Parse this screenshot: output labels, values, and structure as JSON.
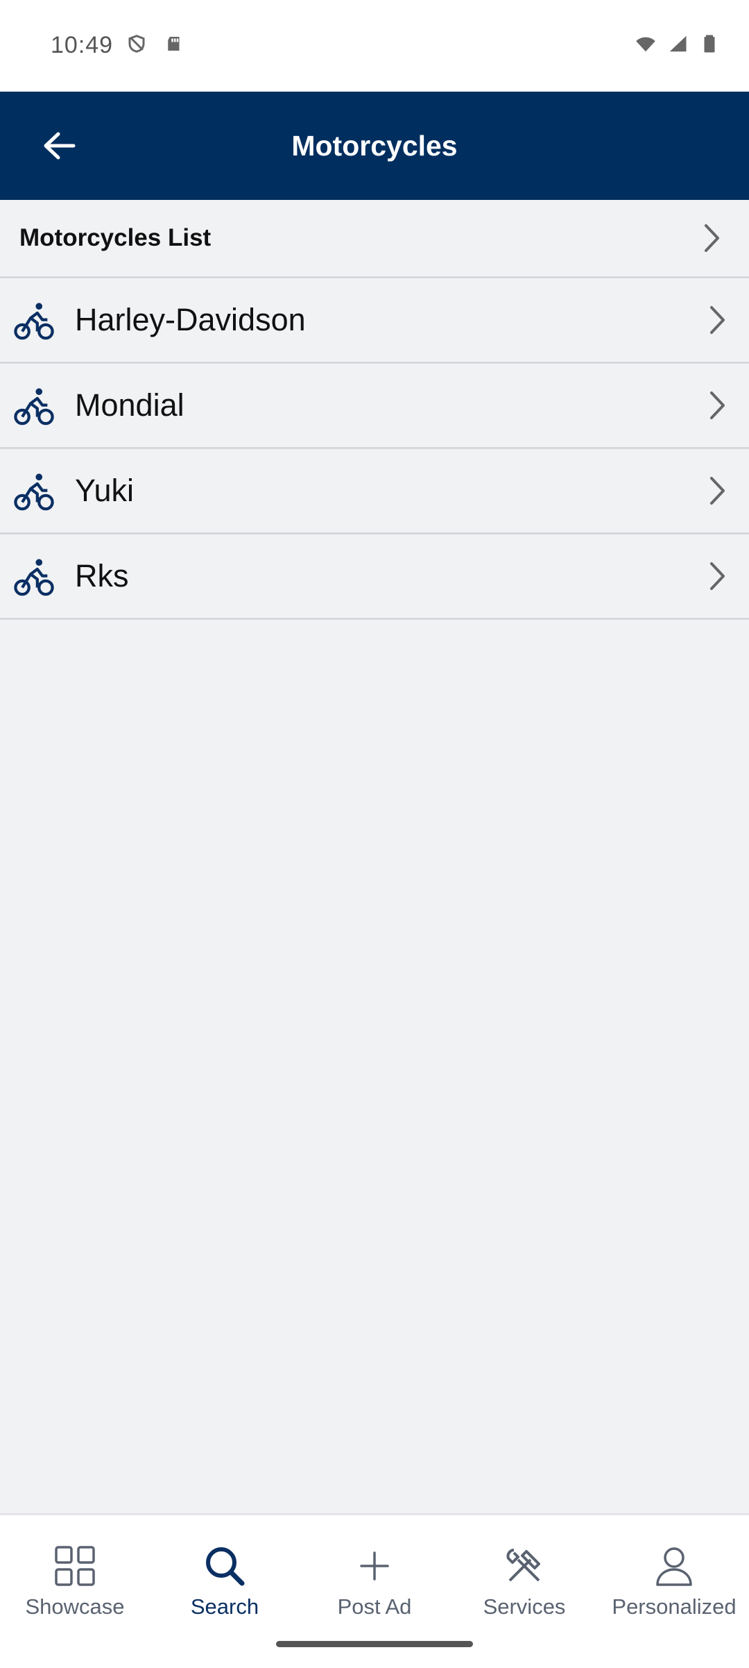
{
  "status_bar": {
    "time": "10:49"
  },
  "app_bar": {
    "title": "Motorcycles"
  },
  "list": {
    "header": "Motorcycles List",
    "items": [
      {
        "label": "Harley-Davidson"
      },
      {
        "label": "Mondial"
      },
      {
        "label": "Yuki"
      },
      {
        "label": "Rks"
      }
    ]
  },
  "bottom_nav": {
    "items": [
      {
        "label": "Showcase",
        "icon": "grid-icon",
        "active": false
      },
      {
        "label": "Search",
        "icon": "search-icon",
        "active": true
      },
      {
        "label": "Post Ad",
        "icon": "plus-icon",
        "active": false
      },
      {
        "label": "Services",
        "icon": "tools-icon",
        "active": false
      },
      {
        "label": "Personalized",
        "icon": "person-icon",
        "active": false
      }
    ]
  },
  "colors": {
    "primary": "#002e5f",
    "background": "#f1f2f4",
    "active_nav": "#0a2f63",
    "inactive_nav": "#5a6270"
  }
}
